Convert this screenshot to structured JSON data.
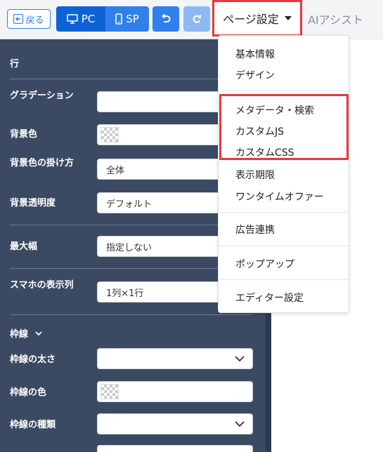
{
  "toolbar": {
    "back_label": "戻る",
    "pc_label": "PC",
    "sp_label": "SP",
    "page_settings_label": "ページ設定",
    "ai_assist_label": "AIアシスト"
  },
  "sidebar": {
    "row_title": "行",
    "gradient_label": "グラデーション",
    "bg_color_label": "背景色",
    "bg_apply_label": "背景色の掛け方",
    "bg_apply_value": "全体",
    "bg_opacity_label": "背景透明度",
    "bg_opacity_value": "デフォルト",
    "max_width_label": "最大幅",
    "max_width_value": "指定しない",
    "sp_display_label": "スマホの表示列",
    "sp_display_value": "1列×1行",
    "border_title": "枠線",
    "border_width_label": "枠線の太さ",
    "border_color_label": "枠線の色",
    "border_type_label": "枠線の種類"
  },
  "menu": {
    "items": [
      "基本情報",
      "デザイン",
      "メタデータ・検索",
      "カスタムJS",
      "カスタムCSS",
      "表示期限",
      "ワンタイムオファー",
      "広告連携",
      "ポップアップ",
      "エディター設定"
    ]
  },
  "colors": {
    "accent": "#2f80ed",
    "sidebar_bg": "#3b4a62",
    "highlight": "#e8383d"
  }
}
